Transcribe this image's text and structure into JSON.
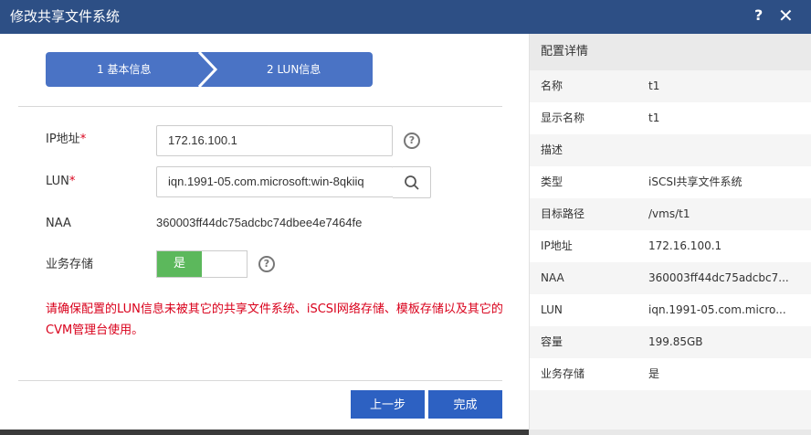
{
  "dialog": {
    "title": "修改共享文件系统",
    "help": "?",
    "close": "✕"
  },
  "steps": [
    {
      "label": "1 基本信息"
    },
    {
      "label": "2 LUN信息"
    }
  ],
  "form": {
    "ip_label": "IP地址",
    "ip_value": "172.16.100.1",
    "lun_label": "LUN",
    "lun_value": "iqn.1991-05.com.microsoft:win-8qkiiq",
    "naa_label": "NAA",
    "naa_value": "360003ff44dc75adcbc74dbee4e7464fe",
    "storage_label": "业务存储",
    "storage_toggle": "是",
    "required_mark": "*",
    "help_mark": "?"
  },
  "warning": "请确保配置的LUN信息未被其它的共享文件系统、iSCSI网络存储、模板存储以及其它的CVM管理台使用。",
  "buttons": {
    "prev": "上一步",
    "done": "完成"
  },
  "details": {
    "title": "配置详情",
    "rows": [
      {
        "k": "名称",
        "v": "t1"
      },
      {
        "k": "显示名称",
        "v": "t1"
      },
      {
        "k": "描述",
        "v": ""
      },
      {
        "k": "类型",
        "v": "iSCSI共享文件系统"
      },
      {
        "k": "目标路径",
        "v": "/vms/t1"
      },
      {
        "k": "IP地址",
        "v": "172.16.100.1"
      },
      {
        "k": "NAA",
        "v": "360003ff44dc75adcbc7..."
      },
      {
        "k": "LUN",
        "v": "iqn.1991-05.com.micro..."
      },
      {
        "k": "容量",
        "v": "199.85GB"
      },
      {
        "k": "业务存储",
        "v": "是"
      }
    ]
  },
  "colors": {
    "titlebar": "#2d4f85",
    "step": "#4a73c5",
    "primary": "#2d61c2",
    "toggle_on": "#5cb85c",
    "warning": "#d9001b"
  }
}
